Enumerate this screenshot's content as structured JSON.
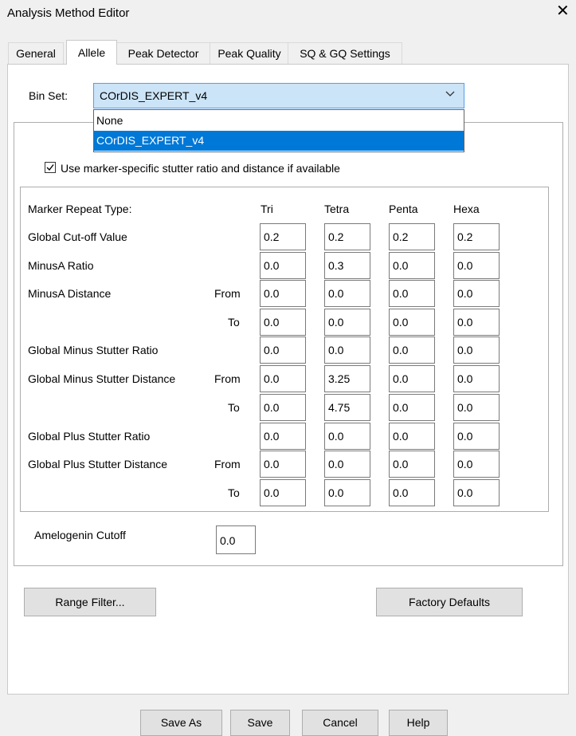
{
  "window": {
    "title": "Analysis Method Editor",
    "close_glyph": "✕"
  },
  "tabs": [
    "General",
    "Allele",
    "Peak Detector",
    "Peak Quality",
    "SQ & GQ Settings"
  ],
  "active_tab": "Allele",
  "bin_set": {
    "label": "Bin Set:",
    "selected": "COrDIS_EXPERT_v4",
    "options": [
      "None",
      "COrDIS_EXPERT_v4"
    ],
    "highlighted_index": 1
  },
  "stutter_checkbox": {
    "label": "Use marker-specific stutter ratio and distance if available",
    "checked": true
  },
  "grid": {
    "header_label": "Marker Repeat Type:",
    "columns": [
      "Tri",
      "Tetra",
      "Penta",
      "Hexa"
    ],
    "rows": [
      {
        "label": "Global Cut-off Value",
        "sub": "",
        "values": [
          "0.2",
          "0.2",
          "0.2",
          "0.2"
        ]
      },
      {
        "label": "MinusA Ratio",
        "sub": "",
        "values": [
          "0.0",
          "0.3",
          "0.0",
          "0.0"
        ]
      },
      {
        "label": "MinusA Distance",
        "sub": "From",
        "values": [
          "0.0",
          "0.0",
          "0.0",
          "0.0"
        ]
      },
      {
        "label": "",
        "sub": "To",
        "values": [
          "0.0",
          "0.0",
          "0.0",
          "0.0"
        ]
      },
      {
        "label": "Global Minus Stutter Ratio",
        "sub": "",
        "values": [
          "0.0",
          "0.0",
          "0.0",
          "0.0"
        ]
      },
      {
        "label": "Global Minus Stutter Distance",
        "sub": "From",
        "values": [
          "0.0",
          "3.25",
          "0.0",
          "0.0"
        ]
      },
      {
        "label": "",
        "sub": "To",
        "values": [
          "0.0",
          "4.75",
          "0.0",
          "0.0"
        ]
      },
      {
        "label": "Global Plus Stutter Ratio",
        "sub": "",
        "values": [
          "0.0",
          "0.0",
          "0.0",
          "0.0"
        ]
      },
      {
        "label": "Global Plus Stutter Distance",
        "sub": "From",
        "values": [
          "0.0",
          "0.0",
          "0.0",
          "0.0"
        ]
      },
      {
        "label": "",
        "sub": "To",
        "values": [
          "0.0",
          "0.0",
          "0.0",
          "0.0"
        ]
      }
    ]
  },
  "amelogenin": {
    "label": "Amelogenin Cutoff",
    "value": "0.0"
  },
  "buttons": {
    "range_filter": "Range Filter...",
    "factory_defaults": "Factory Defaults",
    "save_as": "Save As",
    "save": "Save",
    "cancel": "Cancel",
    "help": "Help"
  }
}
